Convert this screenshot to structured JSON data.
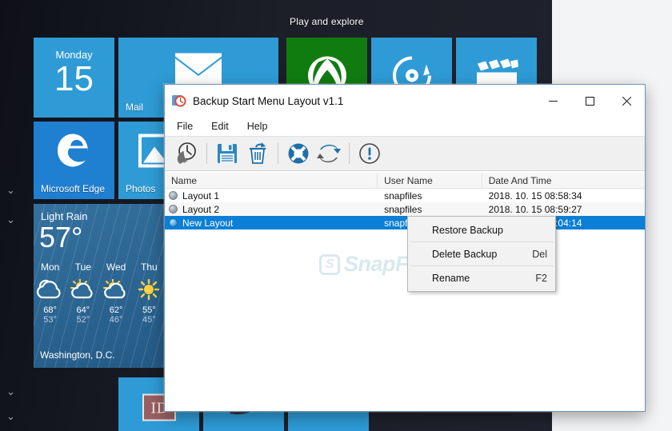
{
  "start_menu": {
    "group_header": "Play and explore",
    "chevrons": [
      "chevron-down",
      "chevron-down",
      "chevron-down",
      "chevron-down"
    ],
    "tiles": [
      {
        "name": "calendar",
        "label": "",
        "day": "Monday",
        "date": "15",
        "color": "#2e9bd6"
      },
      {
        "name": "mail",
        "label": "Mail",
        "glyph": "envelope",
        "color": "#2e9bd6"
      },
      {
        "name": "xbox",
        "label": "",
        "glyph": "xbox",
        "color": "#107c10"
      },
      {
        "name": "groove-music",
        "label": "",
        "glyph": "music-disc",
        "color": "#2e9bd6"
      },
      {
        "name": "movies-tv",
        "label": "",
        "glyph": "clapperboard",
        "color": "#2e9bd6"
      },
      {
        "name": "microsoft-edge",
        "label": "Microsoft Edge",
        "glyph": "edge",
        "color": "#1f7fd0"
      },
      {
        "name": "photos",
        "label": "Photos",
        "glyph": "photo",
        "color": "#2e9bd6"
      },
      {
        "name": "weather",
        "label": "",
        "color": "#2b6796"
      },
      {
        "name": "bottom-tile-id",
        "label": "",
        "glyph": "id",
        "color": "#2e9bd6"
      },
      {
        "name": "bottom-tile-mouse",
        "label": "",
        "glyph": "mouse",
        "color": "#2e9bd6"
      },
      {
        "name": "bottom-tile-plain",
        "label": "",
        "color": "#2e9bd6"
      }
    ],
    "weather": {
      "condition": "Light Rain",
      "temperature": "57°",
      "location": "Washington, D.C.",
      "forecast": [
        {
          "day": "Mon",
          "icon": "cloudy",
          "high": "68°",
          "low": "53°"
        },
        {
          "day": "Tue",
          "icon": "partly-sunny",
          "high": "64°",
          "low": "52°"
        },
        {
          "day": "Wed",
          "icon": "partly-sunny",
          "high": "62°",
          "low": "46°"
        },
        {
          "day": "Thu",
          "icon": "sunny",
          "high": "55°",
          "low": "45°"
        }
      ]
    }
  },
  "app": {
    "icon": "clock-backup-icon",
    "title": "Backup Start Menu Layout v1.1",
    "window_buttons": {
      "minimize": "minimize-icon",
      "maximize": "maximize-icon",
      "close": "close-icon"
    },
    "menu": [
      {
        "name": "file",
        "label": "File"
      },
      {
        "name": "edit",
        "label": "Edit"
      },
      {
        "name": "help",
        "label": "Help"
      }
    ],
    "toolbar": [
      {
        "name": "backup-now-button",
        "icon": "clock-restore-icon",
        "tooltip": "Backup"
      },
      {
        "name": "save-button",
        "icon": "floppy-save-icon",
        "tooltip": "Save"
      },
      {
        "name": "delete-button",
        "icon": "trash-icon",
        "tooltip": "Delete"
      },
      {
        "name": "support-button",
        "icon": "lifebuoy-icon",
        "tooltip": "Support"
      },
      {
        "name": "refresh-button",
        "icon": "refresh-icon",
        "tooltip": "Refresh"
      },
      {
        "name": "about-button",
        "icon": "info-icon",
        "tooltip": "About"
      }
    ],
    "list": {
      "columns": [
        "Name",
        "User Name",
        "Date And Time"
      ],
      "rows": [
        {
          "name": "Layout 1",
          "user": "snapfiles",
          "datetime": "2018. 10. 15 08:58:34",
          "selected": false
        },
        {
          "name": "Layout 2",
          "user": "snapfiles",
          "datetime": "2018. 10. 15 08:59:27",
          "selected": false
        },
        {
          "name": "New Layout",
          "user": "snapfiles",
          "datetime": "2018. 10. 15 09:04:14",
          "selected": true
        }
      ]
    },
    "context_menu": [
      {
        "name": "restore-backup",
        "label": "Restore Backup",
        "accel": ""
      },
      {
        "name": "delete-backup",
        "label": "Delete Backup",
        "accel": "Del"
      },
      {
        "name": "rename",
        "label": "Rename",
        "accel": "F2"
      }
    ]
  },
  "watermark": {
    "text": "SnapFiles",
    "logo": "S"
  },
  "colors": {
    "accent": "#0c7fd6",
    "tile_blue": "#2e9bd6",
    "xbox_green": "#107c10",
    "weather_blue": "#2b6796",
    "start_bg": "#1b1d26"
  }
}
